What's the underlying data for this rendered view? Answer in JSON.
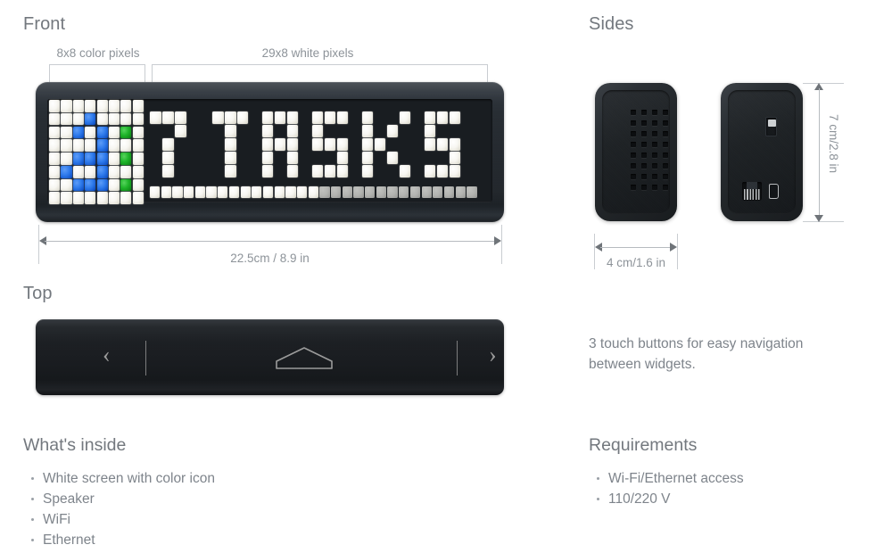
{
  "sections": {
    "front": {
      "title": "Front"
    },
    "sides": {
      "title": "Sides"
    },
    "top": {
      "title": "Top"
    }
  },
  "front": {
    "bracket_left_label": "8x8 color pixels",
    "bracket_right_label": "29x8 white pixels",
    "width_label": "22.5cm / 8.9 in",
    "display": {
      "message": "7 TASKS",
      "icon_grid_colors": {
        "white": "#f7f6f1",
        "blue": "#2f7bec",
        "green": "#1fb52a"
      },
      "progress_total_cells": 29,
      "progress_filled_cells": 15,
      "progress_filled_color": "#ffffff",
      "progress_empty_color": "#a9aaa7"
    }
  },
  "sides": {
    "width_label": "4 cm/1.6 in",
    "height_label": "7 cm/2.8 in",
    "left_panel_feature": "speaker-grille",
    "right_panel_ports": [
      "power-port",
      "ethernet-port",
      "usb-port"
    ]
  },
  "top": {
    "buttons": [
      "prev-arrow",
      "home-button",
      "next-arrow"
    ],
    "prev_glyph": "‹",
    "next_glyph": "›",
    "note": "3 touch buttons for easy navigation between widgets."
  },
  "whats_inside": {
    "title": "What's inside",
    "items": [
      "White screen with color icon",
      "Speaker",
      "WiFi",
      "Ethernet"
    ]
  },
  "requirements": {
    "title": "Requirements",
    "items": [
      "Wi-Fi/Ethernet access",
      "110/220 V"
    ]
  },
  "chart_data": {
    "type": "heatmap",
    "title": "LED matrix display state",
    "icon_matrix_legend": {
      "0": "white",
      "1": "blue",
      "2": "green"
    },
    "icon_matrix": [
      [
        0,
        0,
        0,
        0,
        0,
        0,
        0,
        0
      ],
      [
        0,
        0,
        0,
        1,
        0,
        0,
        0,
        0
      ],
      [
        0,
        0,
        1,
        0,
        1,
        0,
        2,
        0
      ],
      [
        0,
        0,
        0,
        0,
        1,
        0,
        0,
        0
      ],
      [
        0,
        0,
        1,
        1,
        1,
        0,
        2,
        0
      ],
      [
        0,
        1,
        0,
        0,
        1,
        0,
        0,
        0
      ],
      [
        0,
        0,
        1,
        1,
        1,
        0,
        2,
        0
      ],
      [
        0,
        0,
        0,
        0,
        0,
        0,
        0,
        0
      ]
    ],
    "text_matrix_legend": {
      "0": "off",
      "1": "white"
    },
    "text_matrix": [
      [
        1,
        1,
        1,
        0,
        0,
        1,
        1,
        1,
        0,
        1,
        1,
        1,
        0,
        1,
        1,
        1,
        0,
        1,
        0,
        0,
        1,
        0,
        1,
        1,
        1
      ],
      [
        0,
        0,
        1,
        0,
        0,
        0,
        1,
        0,
        0,
        1,
        0,
        1,
        0,
        1,
        0,
        0,
        0,
        1,
        0,
        1,
        0,
        0,
        1,
        0,
        0
      ],
      [
        0,
        1,
        0,
        0,
        0,
        0,
        1,
        0,
        0,
        1,
        1,
        1,
        0,
        1,
        1,
        1,
        0,
        1,
        1,
        0,
        0,
        0,
        1,
        1,
        1
      ],
      [
        0,
        1,
        0,
        0,
        0,
        0,
        1,
        0,
        0,
        1,
        0,
        1,
        0,
        0,
        0,
        1,
        0,
        1,
        0,
        1,
        0,
        0,
        0,
        0,
        1
      ],
      [
        0,
        1,
        0,
        0,
        0,
        0,
        1,
        0,
        0,
        1,
        0,
        1,
        0,
        1,
        1,
        1,
        0,
        1,
        0,
        0,
        1,
        0,
        1,
        1,
        1
      ]
    ],
    "progress_row": [
      1,
      1,
      1,
      1,
      1,
      1,
      1,
      1,
      1,
      1,
      1,
      1,
      1,
      1,
      1,
      0,
      0,
      0,
      0,
      0,
      0,
      0,
      0,
      0,
      0,
      0,
      0,
      0,
      0
    ]
  }
}
